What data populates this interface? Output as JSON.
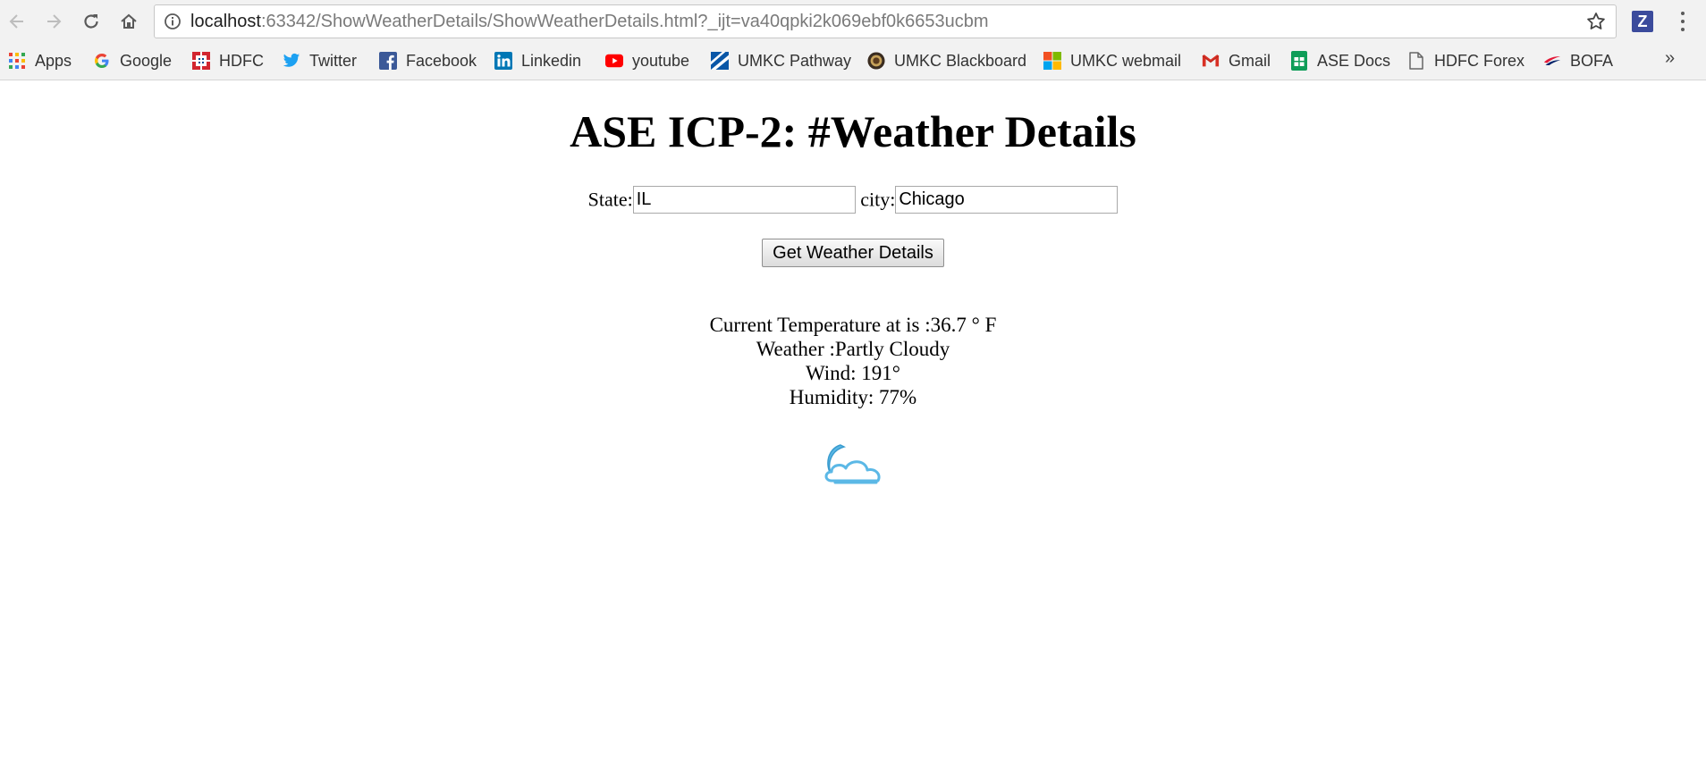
{
  "browser": {
    "url_host": "localhost",
    "url_rest": ":63342/ShowWeatherDetails/ShowWeatherDetails.html?_ijt=va40qpki2k069ebf0k6653ucbm",
    "extension_label": "Z",
    "overflow_label": "»",
    "bookmarks": [
      {
        "label": "Apps",
        "icon": "apps-grid-icon"
      },
      {
        "label": "Google",
        "icon": "google-icon"
      },
      {
        "label": "HDFC",
        "icon": "hdfc-icon"
      },
      {
        "label": "Twitter",
        "icon": "twitter-icon"
      },
      {
        "label": "Facebook",
        "icon": "facebook-icon"
      },
      {
        "label": "Linkedin",
        "icon": "linkedin-icon"
      },
      {
        "label": "youtube",
        "icon": "youtube-icon"
      },
      {
        "label": "UMKC Pathway",
        "icon": "umkc-pathway-icon"
      },
      {
        "label": "UMKC Blackboard",
        "icon": "umkc-blackboard-icon"
      },
      {
        "label": "UMKC webmail",
        "icon": "microsoft-icon"
      },
      {
        "label": "Gmail",
        "icon": "gmail-icon"
      },
      {
        "label": "ASE Docs",
        "icon": "sheets-icon"
      },
      {
        "label": "HDFC Forex",
        "icon": "document-icon"
      },
      {
        "label": "BOFA",
        "icon": "bofa-icon"
      }
    ]
  },
  "page": {
    "title": "ASE ICP-2: #Weather Details",
    "state_label": "State:",
    "state_value": "IL",
    "city_label": "city:",
    "city_value": "Chicago",
    "button_label": "Get Weather Details",
    "temperature_text": "Current Temperature at is :36.7 ° F",
    "weather_text": "Weather :Partly Cloudy",
    "wind_text": "Wind: 191°",
    "humidity_text": "Humidity: 77%",
    "weather_icon": "partly-cloudy-night-icon"
  },
  "colors": {
    "icon_blue": "#5bb8e6",
    "twitter": "#1da1f2",
    "facebook": "#3b5998",
    "linkedin": "#0077b5",
    "youtube": "#ff0000",
    "hdfc": "#d22630"
  }
}
